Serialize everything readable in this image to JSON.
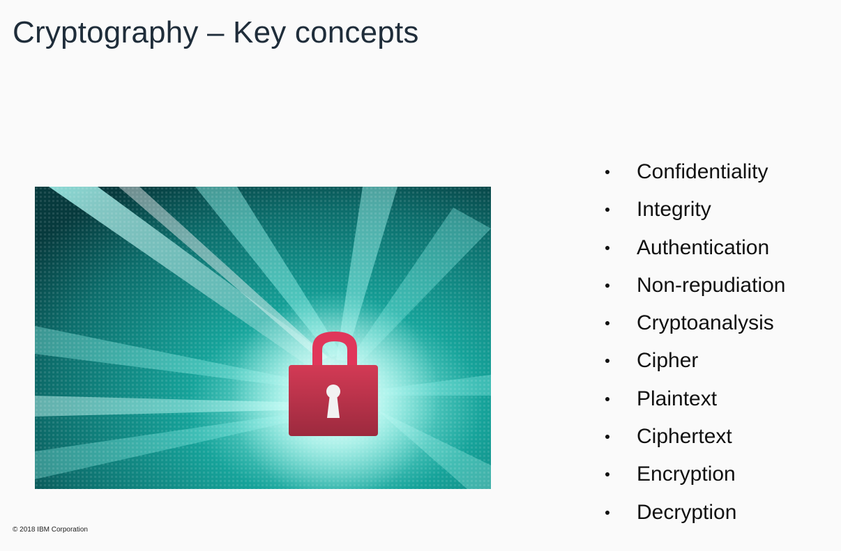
{
  "slide": {
    "title": "Cryptography – Key concepts",
    "copyright": "© 2018 IBM Corporation",
    "image": {
      "subject": "padlock-icon",
      "colors": {
        "background_dark": "#0a3b3d",
        "background_mid": "#128a86",
        "beam": "#6ff6f0",
        "lock_body": "#c8304a",
        "lock_shackle": "#e0365a",
        "keyhole": "#f2f2f2"
      }
    },
    "bullets": [
      "Confidentiality",
      "Integrity",
      "Authentication",
      "Non-repudiation",
      "Cryptoanalysis",
      "Cipher",
      "Plaintext",
      "Ciphertext",
      "Encryption",
      "Decryption"
    ]
  }
}
